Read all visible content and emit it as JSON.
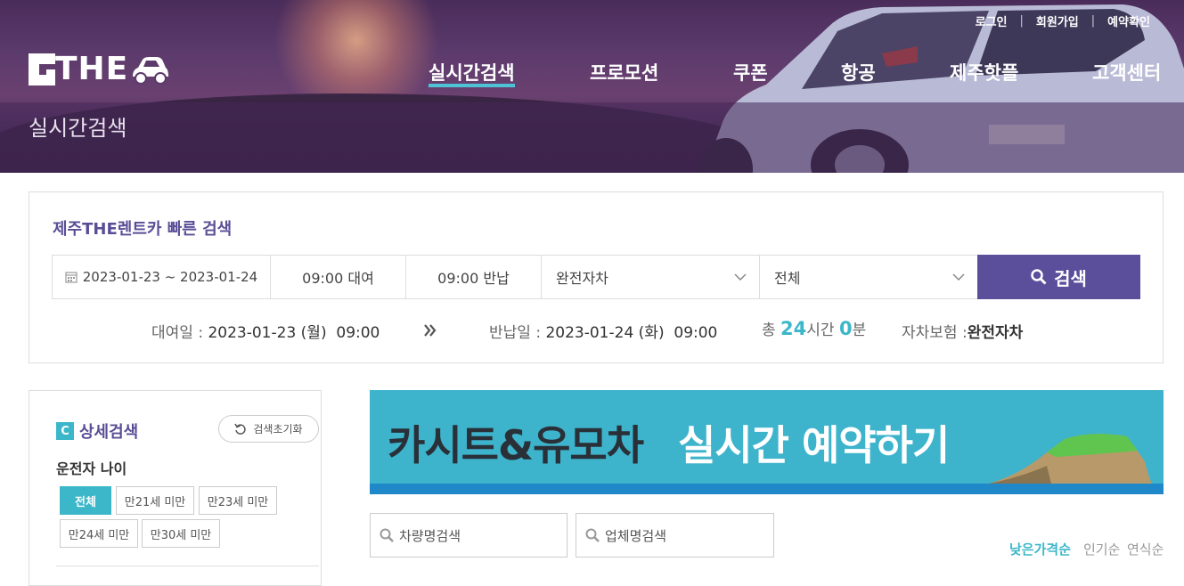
{
  "toplinks": {
    "login": "로그인",
    "signup": "회원가입",
    "reservation_check": "예약확인"
  },
  "logo": {
    "text": "THE"
  },
  "nav": [
    "실시간검색",
    "프로모션",
    "쿠폰",
    "항공",
    "제주핫플",
    "고객센터"
  ],
  "page_title": "실시간검색",
  "quick_search": {
    "title": "제주THE렌트카 빠른 검색",
    "date_range": "2023-01-23 ~ 2023-01-24",
    "pickup_time": "09:00 대여",
    "return_time": "09:00 반납",
    "insurance_select": "완전자차",
    "car_type_select": "전체",
    "search_button": "검색",
    "summary": {
      "pickup_label": "대여일 :",
      "pickup_value": "2023-01-23 (월)  09:00",
      "return_label": "반납일 :",
      "return_value": "2023-01-24 (화)  09:00",
      "total_label": "총",
      "hours": "24",
      "hours_unit": "시간",
      "minutes": "0",
      "minutes_unit": "분",
      "insurance_label": "자차보험 :",
      "insurance_value": "완전자차"
    }
  },
  "sidebar": {
    "title": "상세검색",
    "icon_letter": "C",
    "reset_button": "검색초기화",
    "driver_age_label": "운전자 나이",
    "age_options": [
      "전체",
      "만21세 미만",
      "만23세 미만",
      "만24세 미만",
      "만30세 미만"
    ],
    "selected_age": "전체"
  },
  "banner": {
    "text_dark": "카시트&유모차",
    "text_light": "실시간 예약하기"
  },
  "filters": {
    "car_name_placeholder": "차량명검색",
    "company_placeholder": "업체명검색"
  },
  "sort": {
    "options": [
      "낮은가격순",
      "인기순",
      "연식순"
    ],
    "active": "낮은가격순"
  },
  "colors": {
    "accent": "#3bb7c9",
    "brand_purple": "#5b4f9c",
    "title_purple": "#5a4d96"
  }
}
